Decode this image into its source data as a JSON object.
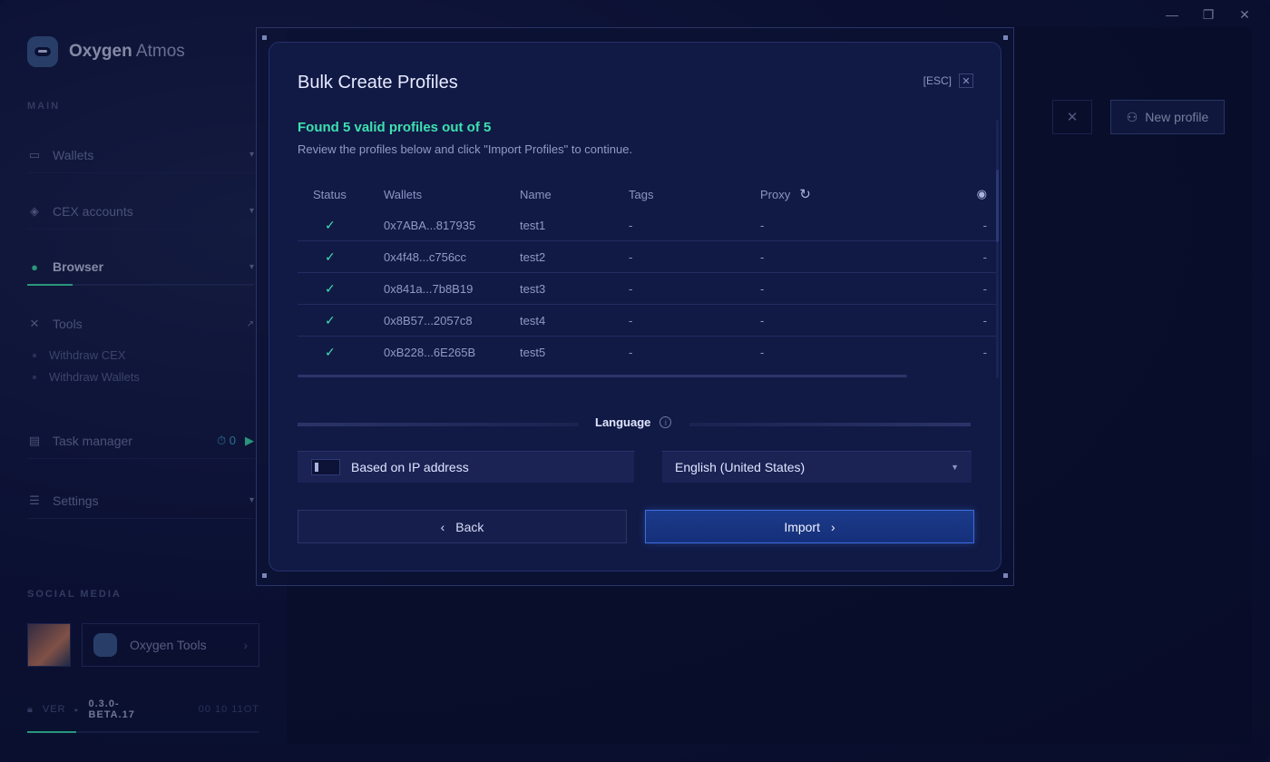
{
  "window": {
    "minimize": "—",
    "restore": "❐",
    "close": "✕"
  },
  "brand": {
    "bold": "Oxygen",
    "rest": " Atmos"
  },
  "sidebar": {
    "main_label": "MAIN",
    "items": [
      {
        "label": "Wallets",
        "icon": "wallet-icon"
      },
      {
        "label": "CEX accounts",
        "icon": "layers-icon"
      },
      {
        "label": "Browser",
        "icon": "globe-icon"
      },
      {
        "label": "Tools",
        "icon": "tools-icon"
      },
      {
        "label": "Task manager",
        "icon": "tasks-icon"
      },
      {
        "label": "Settings",
        "icon": "sliders-icon"
      }
    ],
    "tools_sub": [
      "Withdraw CEX",
      "Withdraw Wallets"
    ],
    "task_timer": "⏱ 0",
    "task_run": "▶",
    "social_label": "SOCIAL MEDIA",
    "oxygen_tools": "Oxygen Tools",
    "ver_label": "VER",
    "version": "0.3.0-BETA.17",
    "ver_time": "00 10 11OT"
  },
  "toolbar": {
    "new_profile": "New profile"
  },
  "modal": {
    "title": "Bulk Create Profiles",
    "esc": "[ESC]",
    "found": "Found 5 valid profiles out of 5",
    "review": "Review the profiles below and click \"Import Profiles\" to continue.",
    "columns": {
      "status": "Status",
      "wallets": "Wallets",
      "name": "Name",
      "tags": "Tags",
      "proxy": "Proxy"
    },
    "rows": [
      {
        "wallet": "0x7ABA...817935",
        "name": "test1",
        "tags": "-",
        "proxy": "-",
        "disc": "-"
      },
      {
        "wallet": "0x4f48...c756cc",
        "name": "test2",
        "tags": "-",
        "proxy": "-",
        "disc": "-"
      },
      {
        "wallet": "0x841a...7b8B19",
        "name": "test3",
        "tags": "-",
        "proxy": "-",
        "disc": "-"
      },
      {
        "wallet": "0x8B57...2057c8",
        "name": "test4",
        "tags": "-",
        "proxy": "-",
        "disc": "-"
      },
      {
        "wallet": "0xB228...6E265B",
        "name": "test5",
        "tags": "-",
        "proxy": "-",
        "disc": "-"
      }
    ],
    "language_label": "Language",
    "ip_toggle": "Based on IP address",
    "language_value": "English (United States)",
    "back": "Back",
    "import": "Import"
  }
}
